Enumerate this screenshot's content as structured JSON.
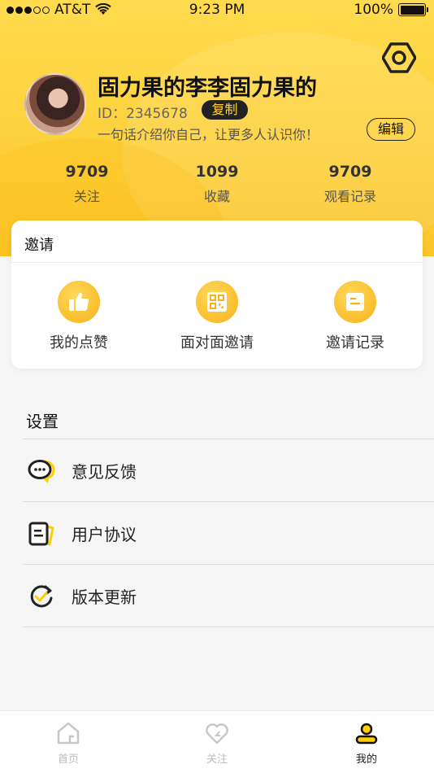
{
  "status_bar": {
    "carrier": "AT&T",
    "time": "9:23 PM",
    "battery": "100%"
  },
  "profile": {
    "name": "固力果的李李固力果的",
    "id": "ID：2345678",
    "copy_label": "复制",
    "bio": "一句话介绍你自己，让更多人认识你！",
    "edit_label": "编辑"
  },
  "stats": [
    {
      "value": "9709",
      "label": "关注"
    },
    {
      "value": "1099",
      "label": "收藏"
    },
    {
      "value": "9709",
      "label": "观看记录"
    }
  ],
  "invite": {
    "title": "邀请",
    "items": [
      {
        "label": "我的点赞",
        "icon": "thumbs-up-icon"
      },
      {
        "label": "面对面邀请",
        "icon": "qr-code-icon"
      },
      {
        "label": "邀请记录",
        "icon": "document-icon"
      }
    ]
  },
  "settings": {
    "title": "设置",
    "items": [
      {
        "label": "意见反馈",
        "icon": "chat-bubble-icon"
      },
      {
        "label": "用户协议",
        "icon": "agreement-icon"
      },
      {
        "label": "版本更新",
        "icon": "refresh-check-icon"
      }
    ]
  },
  "tabbar": {
    "tabs": [
      {
        "label": "首页",
        "icon": "home-icon"
      },
      {
        "label": "关注",
        "icon": "heart-icon"
      },
      {
        "label": "我的",
        "icon": "user-icon"
      }
    ],
    "active_index": 2
  },
  "colors": {
    "accent": "#fdd13c",
    "accent_dark": "#f7b21a",
    "text": "#222222"
  }
}
